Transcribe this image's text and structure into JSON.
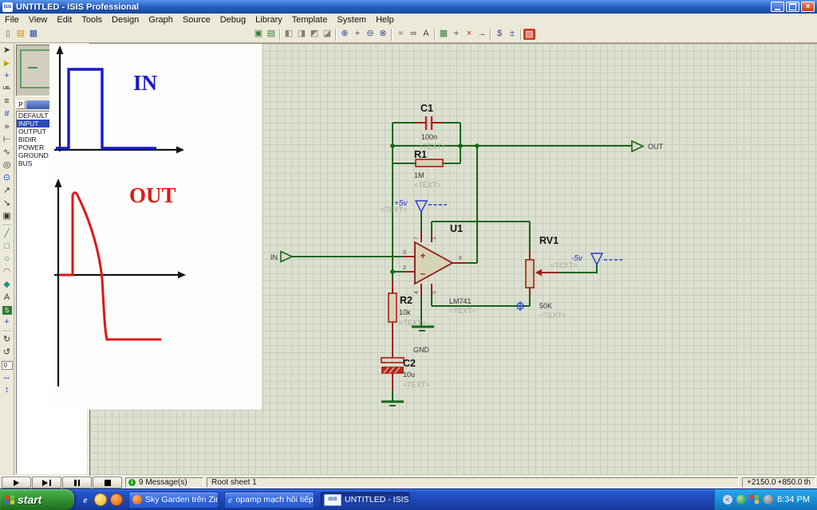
{
  "titlebar": {
    "icon_text": "ISIS",
    "title": "UNTITLED - ISIS Professional",
    "close_glyph": "×"
  },
  "menubar": {
    "items": [
      "File",
      "View",
      "Edit",
      "Tools",
      "Design",
      "Graph",
      "Source",
      "Debug",
      "Library",
      "Template",
      "System",
      "Help"
    ]
  },
  "toolbar": {
    "icons": [
      {
        "n": "new-design",
        "g": "▯"
      },
      {
        "n": "open-design",
        "g": "▤"
      },
      {
        "n": "save-design",
        "g": "▦"
      },
      {
        "n": "copy-sheet",
        "g": "▣"
      },
      {
        "n": "paste-sheet",
        "g": "▤"
      },
      {
        "n": "block-copy",
        "g": "◧"
      },
      {
        "n": "block-move",
        "g": "◨"
      },
      {
        "n": "block-rotate",
        "g": "◩"
      },
      {
        "n": "block-delete",
        "g": "◪"
      },
      {
        "n": "zoom-in",
        "g": "⊕"
      },
      {
        "n": "zoom-center",
        "g": "+"
      },
      {
        "n": "zoom-out",
        "g": "⊖"
      },
      {
        "n": "zoom-all",
        "g": "⊗"
      },
      {
        "n": "wire-autorouter",
        "g": "≈"
      },
      {
        "n": "search-tag",
        "g": "∞"
      },
      {
        "n": "property-assignment",
        "g": "A"
      },
      {
        "n": "design-explorer",
        "g": "▦"
      },
      {
        "n": "new-sheet",
        "g": "+"
      },
      {
        "n": "remove-sheet",
        "g": "×"
      },
      {
        "n": "goto-sheet",
        "g": "→"
      },
      {
        "n": "script-editor",
        "g": "$"
      },
      {
        "n": "script-blocks",
        "g": "±"
      },
      {
        "n": "template-editor",
        "g": "▨"
      }
    ]
  },
  "palette": {
    "icons": [
      {
        "n": "selection-pointer",
        "g": "➤"
      },
      {
        "n": "component-mode",
        "g": "▶"
      },
      {
        "n": "junction-dot",
        "g": "+"
      },
      {
        "n": "wire-label",
        "g": "LBL"
      },
      {
        "n": "text-script",
        "g": "≡"
      },
      {
        "n": "buses",
        "g": "#"
      },
      {
        "n": "terminals-mode",
        "g": "»"
      },
      {
        "n": "device-pins",
        "g": "⊢"
      },
      {
        "n": "graph-mode",
        "g": "∿"
      },
      {
        "n": "tape-recorder",
        "g": "◎"
      },
      {
        "n": "generator-mode",
        "g": "⊙"
      },
      {
        "n": "voltage-probe",
        "g": "↗"
      },
      {
        "n": "current-probe",
        "g": "↘"
      },
      {
        "n": "virtual-instruments",
        "g": "▣"
      },
      {
        "n": "2d-line",
        "g": "╱"
      },
      {
        "n": "2d-box",
        "g": "□"
      },
      {
        "n": "2d-circle",
        "g": "○"
      },
      {
        "n": "2d-arc",
        "g": "◠"
      },
      {
        "n": "2d-path",
        "g": "◆"
      },
      {
        "n": "2d-text",
        "g": "A"
      },
      {
        "n": "2d-symbol",
        "g": "S"
      },
      {
        "n": "2d-marker",
        "g": "+"
      }
    ],
    "orientation": [
      {
        "n": "rotate-clockwise",
        "g": "↻"
      },
      {
        "n": "rotate-anticlockwise",
        "g": "↺"
      },
      {
        "n": "angle",
        "g": "0"
      },
      {
        "n": "flip-horizontal",
        "g": "↔"
      },
      {
        "n": "flip-vertical",
        "g": "↕"
      }
    ]
  },
  "selector": {
    "p_button": "P",
    "items": [
      {
        "label": "DEFAULT"
      },
      {
        "label": "INPUT"
      },
      {
        "label": "OUTPUT"
      },
      {
        "label": "BIDIR"
      },
      {
        "label": "POWER"
      },
      {
        "label": "GROUND"
      },
      {
        "label": "BUS"
      }
    ]
  },
  "sketch": {
    "in_label": "IN",
    "out_label": "OUT"
  },
  "schematic": {
    "c1": {
      "ref": "C1",
      "value": "100n",
      "text": "<TEXT>"
    },
    "r1": {
      "ref": "R1",
      "value": "1M",
      "text": "<TEXT>"
    },
    "u1": {
      "ref": "U1",
      "value": "LM741",
      "text": "<TEXT>"
    },
    "r2": {
      "ref": "R2",
      "value": "10k",
      "text": "<TEXT>"
    },
    "c2": {
      "ref": "C2",
      "value": "10u",
      "text": "<TEXT>"
    },
    "rv1": {
      "ref": "RV1",
      "value": "50K",
      "text": "<TEXT>"
    },
    "vplus": {
      "label": "+5v",
      "text": "<TEXT>"
    },
    "vminus": {
      "label": "-5v",
      "text": "<TEXT>"
    },
    "gnd_label": "GND",
    "in_label": "IN",
    "out_label": "OUT",
    "pins": {
      "p1": "1",
      "p2": "2",
      "p3": "3",
      "p4": "4",
      "p5": "5",
      "p6": "6",
      "p7": "7"
    },
    "plus": "+",
    "minus": "–"
  },
  "statusbar": {
    "info_glyph": "i",
    "messages": "9 Message(s)",
    "sheet": "Root sheet 1",
    "coord_x": "+2150.0",
    "coord_y": "+850.0",
    "units": "th"
  },
  "taskbar": {
    "start": "start",
    "buttons": [
      {
        "label": "Sky Garden trên Zing ..."
      },
      {
        "label": "opamp mạch hồi tiếp ..."
      },
      {
        "label": "UNTITLED - ISIS Prof..."
      }
    ],
    "isis_icon_text": "ISIS",
    "ie_glyph": "e",
    "time": "8:34 PM"
  }
}
